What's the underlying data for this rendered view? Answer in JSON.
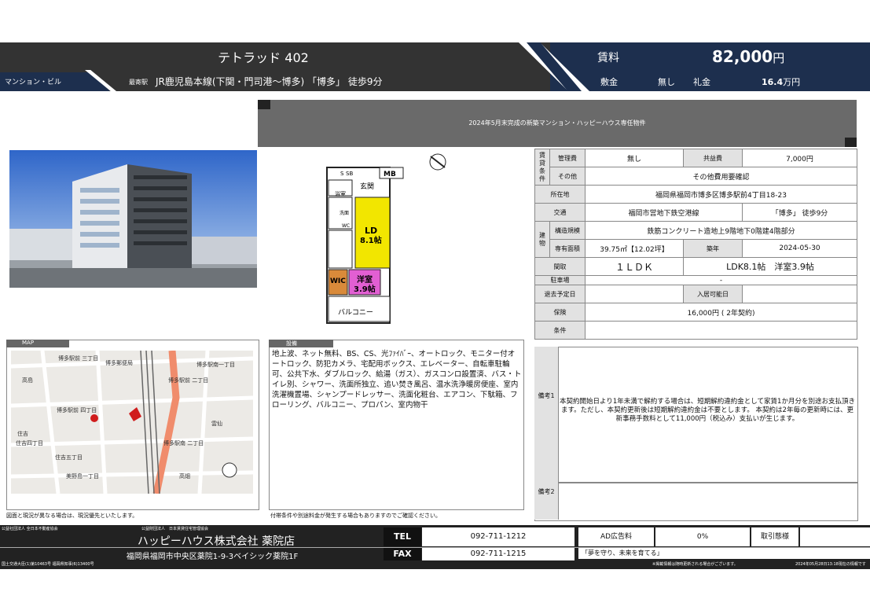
{
  "header": {
    "title": "テトラッド 402",
    "property_type": "マンション・ビル",
    "station_label": "最寄駅",
    "station": "JR鹿児島本線(下関・門司港～博多) 「博多」 徒歩9分",
    "rent_label": "賃料",
    "rent_value": "82,000",
    "rent_unit": "円",
    "deposit_label": "敷金",
    "deposit_value": "無し",
    "key_money_label": "礼金",
    "key_money_value": "16.4",
    "key_money_unit": "万円"
  },
  "banner": "2024年5月末完成の新築マンション・ハッピーハウス専任物件",
  "floorplan": {
    "labels": [
      "S",
      "SB",
      "MB",
      "玄関",
      "浴室",
      "洗面",
      "WC",
      "LD",
      "8.1帖",
      "WIC",
      "洋室",
      "3.9帖",
      "バルコニー"
    ]
  },
  "info": {
    "rent_group": "賃貸条件",
    "mgmt_label": "管理費",
    "mgmt_value": "無し",
    "common_label": "共益費",
    "common_value": "7,000円",
    "other_label": "その他",
    "other_value": "その他費用要確認",
    "location_label": "所在地",
    "location_value": "福岡県福岡市博多区博多駅前4丁目18-23",
    "transport_label": "交通",
    "transport_line": "福岡市営地下鉄空港線",
    "transport_station": "「博多」 徒歩9分",
    "building_group": "建物",
    "structure_label": "構造規模",
    "structure_value": "鉄筋コンクリート造地上9階地下0階建4階部分",
    "area_label": "専有面積",
    "area_value": "39.75㎡【12.02坪】",
    "built_label": "築年",
    "built_value": "2024-05-30",
    "layout_label": "間取",
    "layout_value": "１ＬＤＫ",
    "layout_detail": "LDK8.1帖　洋室3.9帖",
    "parking_label": "駐車場",
    "parking_value": "-",
    "leave_label": "退去予定日",
    "leave_value": "",
    "movein_label": "入居可能日",
    "movein_value": "",
    "insurance_label": "保険",
    "insurance_value": "16,000円 ( 2年契約)",
    "conditions_label": "条件",
    "conditions_value": ""
  },
  "map": {
    "label": "MAP",
    "note": "図面と現況が異なる場合は、現況優先といたします。",
    "place_labels": [
      "博多駅前 三丁目",
      "博多郵便局",
      "博多駅南一丁目",
      "博多駅前 四丁目",
      "博多駅前 二丁目",
      "住吉",
      "住吉四丁目",
      "住吉五丁目",
      "美野島一丁目",
      "博多駅南 二丁目",
      "高畑",
      "雲仙",
      "高島"
    ]
  },
  "equipment": {
    "label": "設備",
    "text": "地上波、ネット無料、BS、CS、光ﾌｧｲﾊﾞｰ、オートロック、モニター付オートロック、防犯カメラ、宅配用ボックス、エレベーター、自転車駐輪可、公共下水、ダブルロック、給湯（ガス）、ガスコンロ設置済、バス・トイレ別、シャワー、洗面所独立、追い焚き風呂、温水洗浄暖房便座、室内洗濯機置場、シャンプードレッサー、洗面化粧台、エアコン、下駄箱、フローリング、バルコニー、プロパン、室内物干",
    "note": "付帯条件や別途料金が発生する場合もありますのでご確認ください。"
  },
  "remarks": {
    "label1": "備考1",
    "text1": "本契約開始日より1年未満で解約する場合は、短期解約違約金として家賃1か月分を別途お支払頂きます。ただし、本契約更新後は短期解約違約金は不要とします。 本契約は2年毎の更新時には、更新事務手数料として11,000円（税込み）支払いが生じます。",
    "label2": "備考2"
  },
  "footer": {
    "assoc1": "公益社団法人 全日本不動産協会",
    "assoc2": "公益財団法人　日本賃貸住宅管理協会",
    "company": "ハッピーハウス株式会社 薬院店",
    "address": "福岡県福岡市中央区薬院1-9-3ベイシック薬院1F",
    "license": "国土交通大臣(1)第10463号 福岡県知事(6)13400号",
    "tel_label": "TEL",
    "tel": "092-711-1212",
    "fax_label": "FAX",
    "fax": "092-711-1215",
    "ad_label": "AD広告料",
    "ad_value": "0%",
    "trade_label": "取引態様",
    "trade_value": "",
    "slogan": "「夢を守り、未来を育てる」",
    "disclaimer": "※掲載情報は随時更新される場合がございます。",
    "date_note": "2024年05月28日13:18現在の情報です"
  },
  "colors": {
    "navy": "#1d2f4e",
    "dark": "#333333",
    "banner": "#6a6a6a",
    "ld": "#f2e600",
    "wic": "#d98a3a",
    "room": "#e25fd3"
  }
}
